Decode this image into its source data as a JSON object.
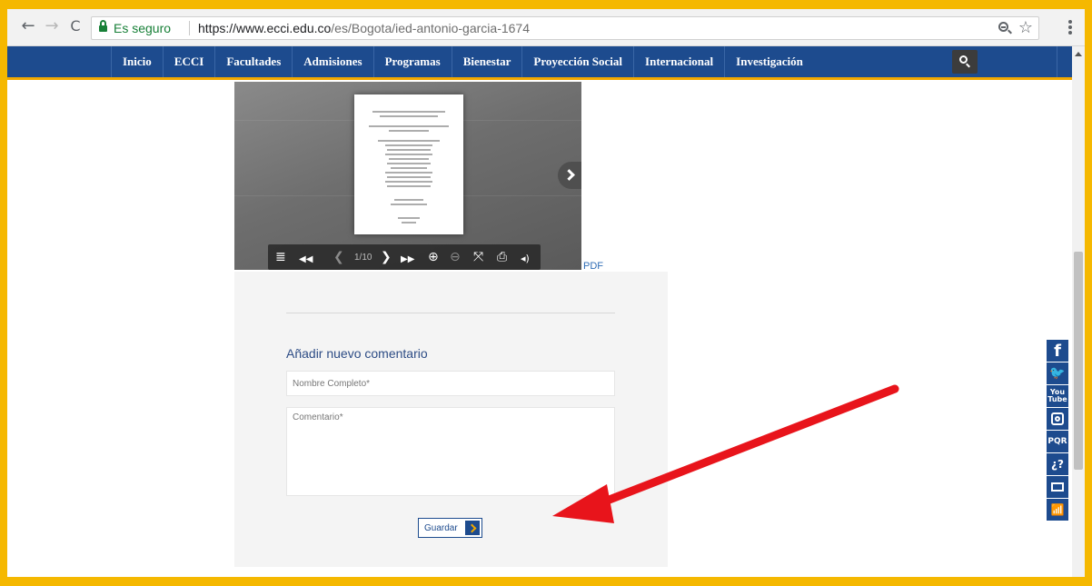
{
  "browser": {
    "back_icon": "←",
    "forward_icon": "→",
    "reload_icon": "C",
    "secure_label": "Es seguro",
    "url_host": "https://www.ecci.edu.co",
    "url_path": "/es/Bogota/ied-antonio-garcia-1674",
    "star_icon": "☆"
  },
  "nav": {
    "items": [
      "Inicio",
      "ECCI",
      "Facultades",
      "Admisiones",
      "Programas",
      "Bienestar",
      "Proyección Social",
      "Internacional",
      "Investigación"
    ]
  },
  "viewer": {
    "page_indicator": "1/10",
    "pdf_label": "PDF",
    "icons": {
      "list": "≣",
      "first": "◀◀",
      "prev": "❮",
      "next": "❯",
      "last": "▶▶",
      "zoom_in": "⊕",
      "zoom_out": "⊖",
      "fullscreen": "⤧",
      "pdf": "⎙",
      "sound": "◂)"
    }
  },
  "comment_form": {
    "title": "Añadir nuevo comentario",
    "name_placeholder": "Nombre Completo*",
    "comment_placeholder": "Comentario*",
    "save_label": "Guardar"
  },
  "social": {
    "facebook": "f",
    "twitter": "🐦",
    "youtube_top": "You",
    "youtube_bottom": "Tube",
    "pqr": "PQR",
    "help": "¿?",
    "stats": "📶"
  },
  "colors": {
    "frame": "#f5b800",
    "nav_bg": "#1d4b8e",
    "nav_accent": "#f0a800",
    "annotation_arrow": "#e8141b",
    "secure_green": "#188038"
  }
}
